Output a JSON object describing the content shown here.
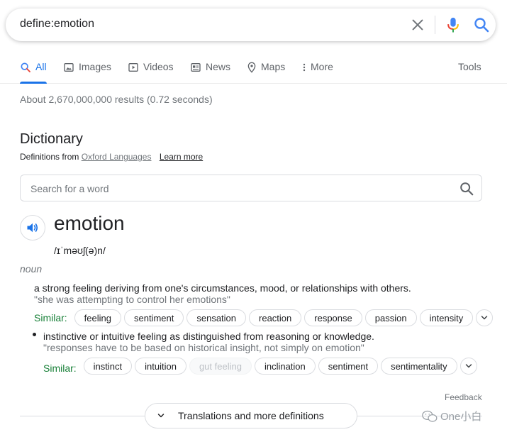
{
  "search": {
    "query": "define:emotion"
  },
  "tabs": [
    {
      "label": "All",
      "active": true
    },
    {
      "label": "Images"
    },
    {
      "label": "Videos"
    },
    {
      "label": "News"
    },
    {
      "label": "Maps"
    },
    {
      "label": "More"
    }
  ],
  "tools_label": "Tools",
  "result_stats": "About 2,670,000,000 results (0.72 seconds)",
  "dictionary": {
    "title": "Dictionary",
    "definitions_from": "Definitions from",
    "source": "Oxford Languages",
    "learn_more": "Learn more",
    "search_placeholder": "Search for a word",
    "word": "emotion",
    "pronunciation": "/ɪˈməʊʃ(ə)n/",
    "part_of_speech": "noun",
    "senses": [
      {
        "definition": "a strong feeling deriving from one's circumstances, mood, or relationships with others.",
        "example": "\"she was attempting to control her emotions\"",
        "similar_label": "Similar:",
        "similar": [
          "feeling",
          "sentiment",
          "sensation",
          "reaction",
          "response",
          "passion",
          "intensity"
        ]
      },
      {
        "definition": "instinctive or intuitive feeling as distinguished from reasoning or knowledge.",
        "example": "\"responses have to be based on historical insight, not simply on emotion\"",
        "similar_label": "Similar:",
        "similar": [
          "instinct",
          "intuition",
          "gut feeling",
          "inclination",
          "sentiment",
          "sentimentality"
        ]
      }
    ]
  },
  "feedback": "Feedback",
  "more_definitions": "Translations and more definitions",
  "watermark": "One小白",
  "colors": {
    "accent": "#1a73e8",
    "similar_green": "#188038",
    "muted": "#70757a"
  }
}
